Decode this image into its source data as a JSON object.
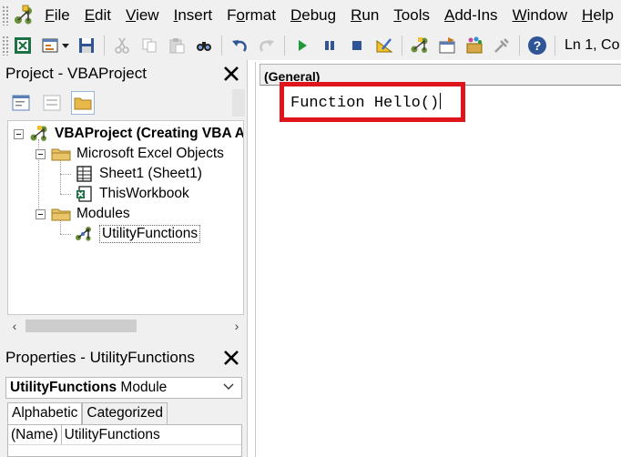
{
  "menubar": {
    "items": [
      {
        "label": "File",
        "u": "F"
      },
      {
        "label": "Edit",
        "u": "E"
      },
      {
        "label": "View",
        "u": "V"
      },
      {
        "label": "Insert",
        "u": "I"
      },
      {
        "label": "Format",
        "u": "o"
      },
      {
        "label": "Debug",
        "u": "D"
      },
      {
        "label": "Run",
        "u": "R"
      },
      {
        "label": "Tools",
        "u": "T"
      },
      {
        "label": "Add-Ins",
        "u": "A"
      },
      {
        "label": "Window",
        "u": "W"
      },
      {
        "label": "Help",
        "u": "H"
      }
    ]
  },
  "toolbar": {
    "icons": [
      "view-excel-icon",
      "insert-userform-icon",
      "save-icon",
      "cut-icon",
      "copy-icon",
      "paste-icon",
      "find-icon",
      "undo-icon",
      "redo-icon",
      "run-icon",
      "break-icon",
      "reset-icon",
      "design-mode-icon",
      "project-explorer-icon",
      "properties-window-icon",
      "object-browser-icon",
      "toolbox-icon",
      "help-icon"
    ],
    "status": "Ln 1, Co"
  },
  "project": {
    "title": "Project - VBAProject",
    "tree": {
      "root": "VBAProject (Creating VBA Add-In)",
      "folder_excel": "Microsoft Excel Objects",
      "sheet1": "Sheet1 (Sheet1)",
      "workbook": "ThisWorkbook",
      "folder_modules": "Modules",
      "module": "UtilityFunctions"
    }
  },
  "properties": {
    "title": "Properties - UtilityFunctions",
    "object_name": "UtilityFunctions",
    "object_type": "Module",
    "tabs": [
      "Alphabetic",
      "Categorized"
    ],
    "rows": [
      {
        "name": "(Name)",
        "value": "UtilityFunctions"
      }
    ]
  },
  "code": {
    "object_combo": "(General)",
    "line1": "Function Hello()"
  },
  "colors": {
    "highlight": "#e0151b",
    "chrome": "#f0f0f0"
  }
}
